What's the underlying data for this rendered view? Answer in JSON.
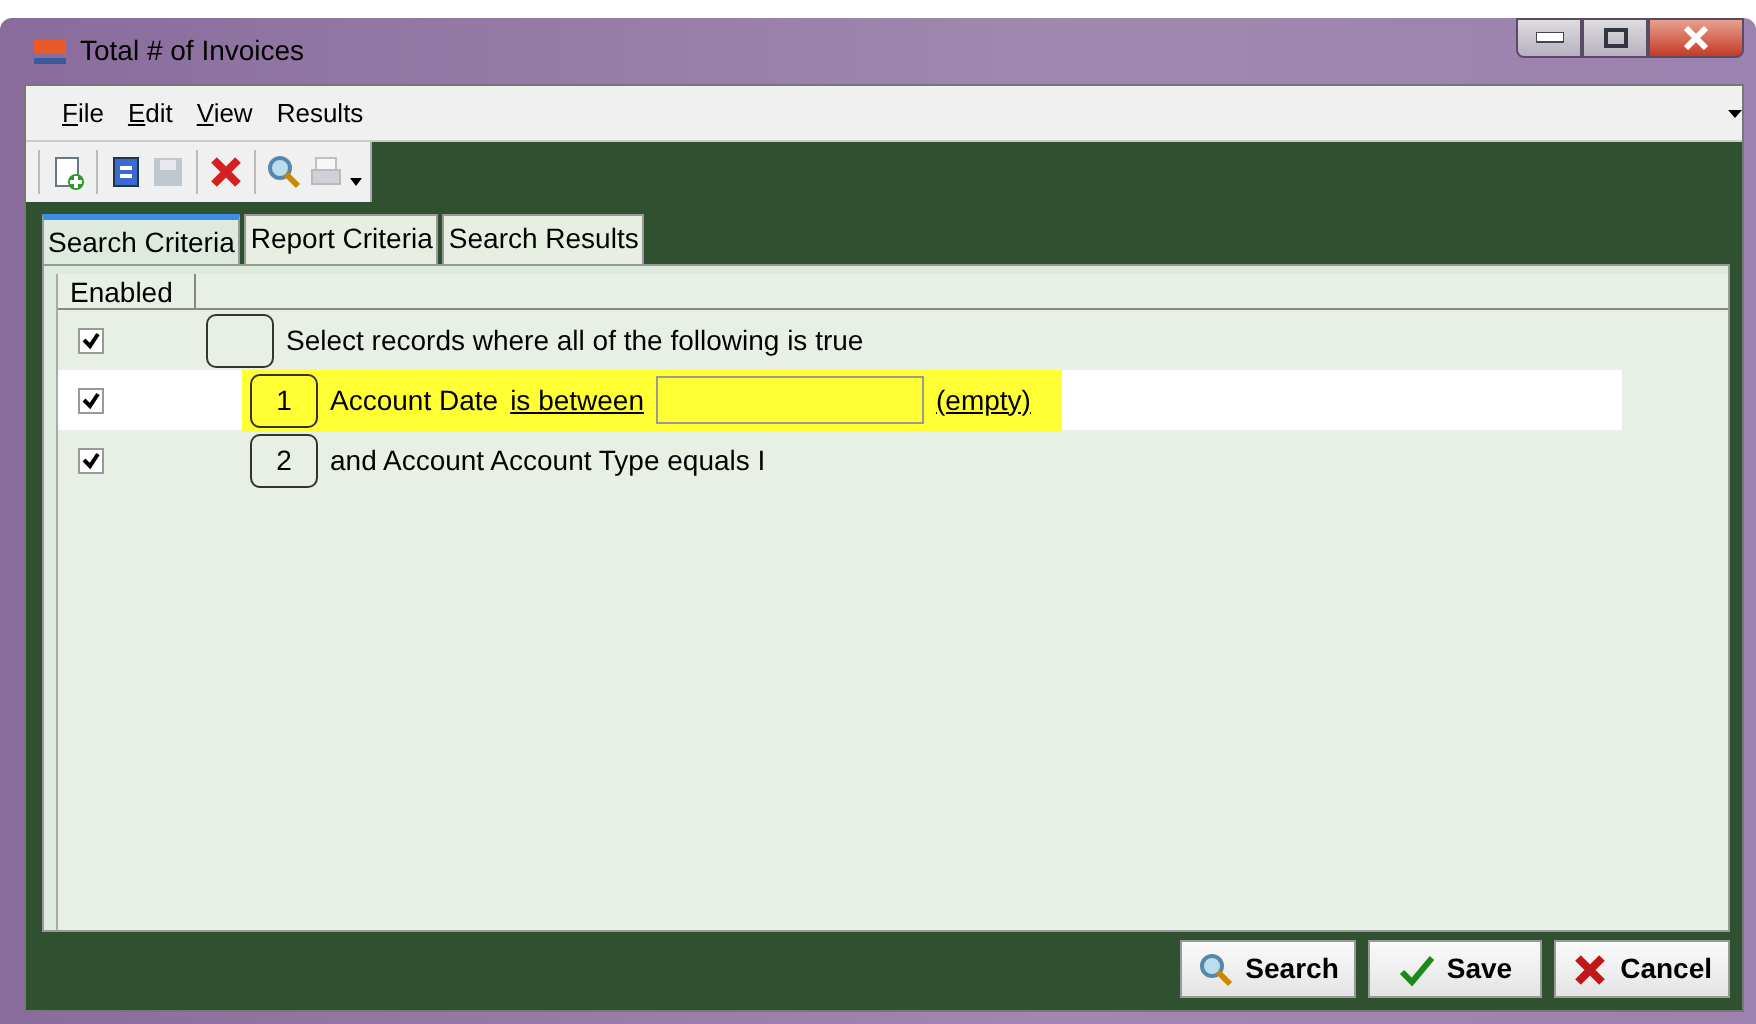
{
  "window": {
    "title": "Total # of Invoices"
  },
  "menu": [
    {
      "label": "File",
      "mnemonic": true
    },
    {
      "label": "Edit",
      "mnemonic": true
    },
    {
      "label": "View",
      "mnemonic": true
    },
    {
      "label": "Results",
      "mnemonic": false
    }
  ],
  "toolbar": [
    {
      "kind": "new",
      "disabled": false
    },
    {
      "kind": "refresh",
      "disabled": false
    },
    {
      "kind": "save",
      "disabled": true
    },
    {
      "kind": "delete",
      "disabled": false
    },
    {
      "kind": "search",
      "disabled": false
    },
    {
      "kind": "print",
      "disabled": true
    }
  ],
  "tabs": [
    {
      "label": "Search Criteria",
      "selected": true
    },
    {
      "label": "Report Criteria",
      "selected": false
    },
    {
      "label": "Search Results",
      "selected": false
    }
  ],
  "grid": {
    "columns": [
      "Enabled"
    ],
    "rows": [
      {
        "enabled": true,
        "selected": false,
        "highlighted": false,
        "parts": [
          {
            "kind": "text",
            "text": "Select records where all of the following is true"
          }
        ],
        "children": [
          {
            "enabled": true,
            "selected": true,
            "highlighted": true,
            "number": "1",
            "parts": [
              {
                "kind": "text",
                "text": "Account Date"
              },
              {
                "kind": "link",
                "text": "is between"
              },
              {
                "kind": "field"
              },
              {
                "kind": "link",
                "text": "(empty)"
              }
            ]
          },
          {
            "enabled": true,
            "selected": false,
            "highlighted": false,
            "number": "2",
            "parts": [
              {
                "kind": "text",
                "text": "and Account Account Type equals I"
              }
            ]
          }
        ]
      }
    ]
  },
  "buttons": [
    {
      "kind": "search",
      "label": "Search"
    },
    {
      "kind": "save",
      "label": "Save"
    },
    {
      "kind": "cancel",
      "label": "Cancel"
    }
  ]
}
